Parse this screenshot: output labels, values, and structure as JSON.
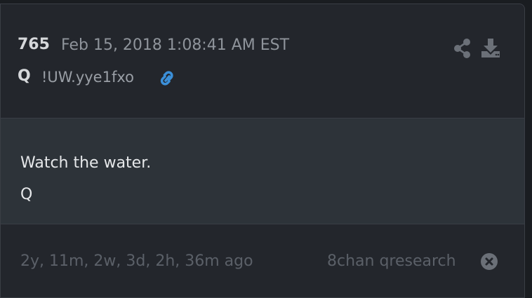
{
  "post": {
    "number": "765",
    "date": "Feb 15, 2018 1:08:41 AM EST",
    "author": "Q",
    "tripcode": "!UW.yye1fxo"
  },
  "content": {
    "lines": [
      "Watch the water.",
      "Q"
    ]
  },
  "footer": {
    "age": "2y, 11m, 2w, 3d, 2h, 36m ago",
    "source": "8chan qresearch"
  },
  "icons": {
    "link": "link-icon",
    "share": "share-icon",
    "download": "download-icon",
    "close": "close-circle-icon"
  },
  "colors": {
    "link_accent": "#3b8fd9",
    "card_bg": "#23262c",
    "body_bg": "#2d3339"
  }
}
